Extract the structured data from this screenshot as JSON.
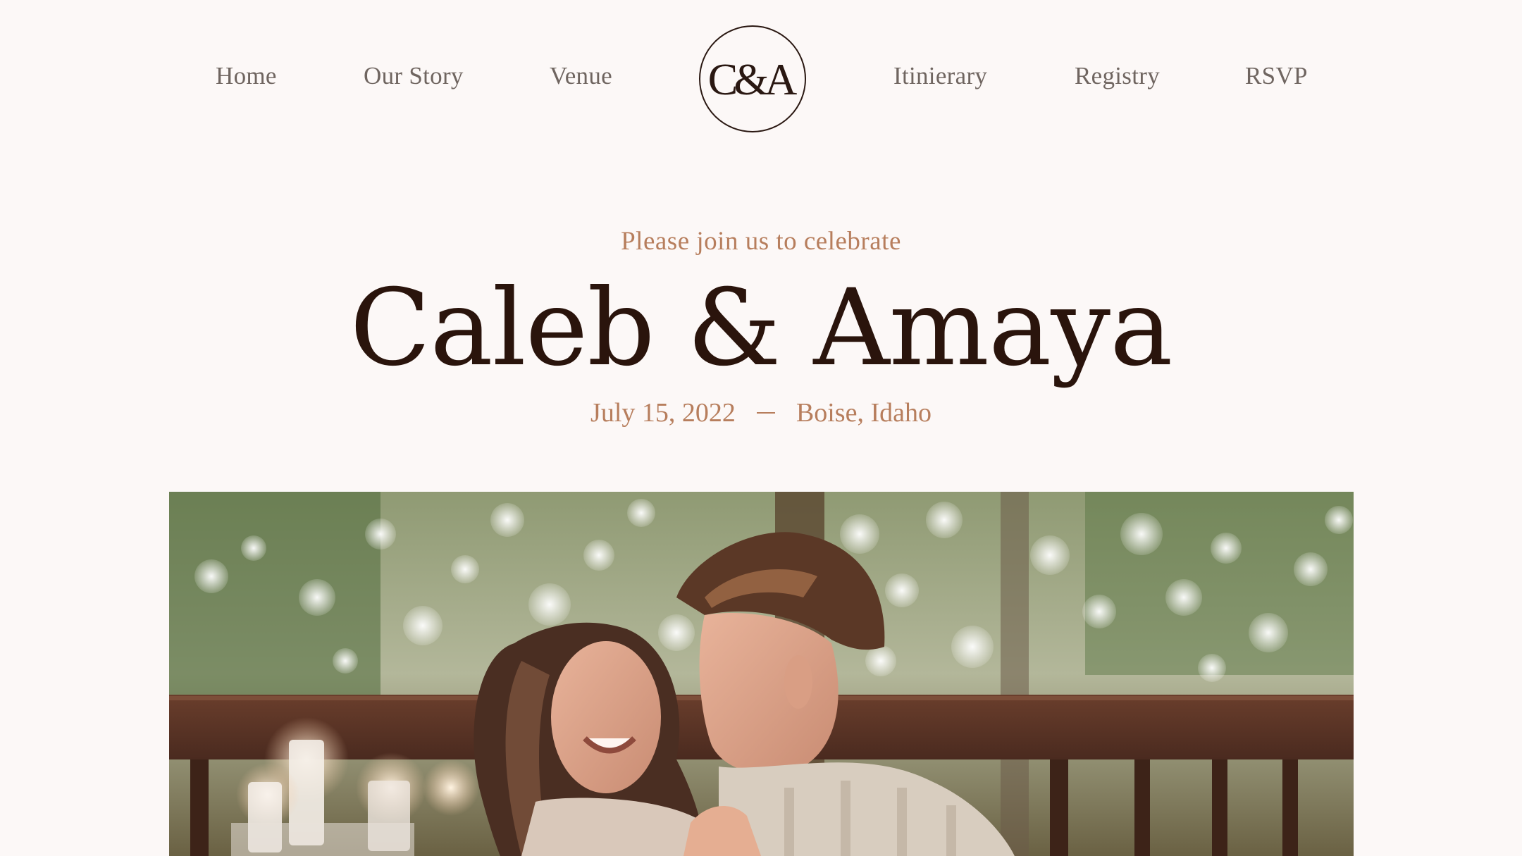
{
  "nav": {
    "left_items": [
      {
        "label": "Home"
      },
      {
        "label": "Our Story"
      },
      {
        "label": "Venue"
      }
    ],
    "monogram": "C&A",
    "right_items": [
      {
        "label": "Itinierary"
      },
      {
        "label": "Registry"
      },
      {
        "label": "RSVP"
      }
    ]
  },
  "hero": {
    "tagline": "Please join us to celebrate",
    "names": "Caleb & Amaya",
    "date": "July 15, 2022",
    "location": "Boise, Idaho"
  },
  "colors": {
    "background": "#fcf8f7",
    "accent": "#b77e5d",
    "heading": "#2a140c",
    "nav_text": "#6f6560"
  }
}
